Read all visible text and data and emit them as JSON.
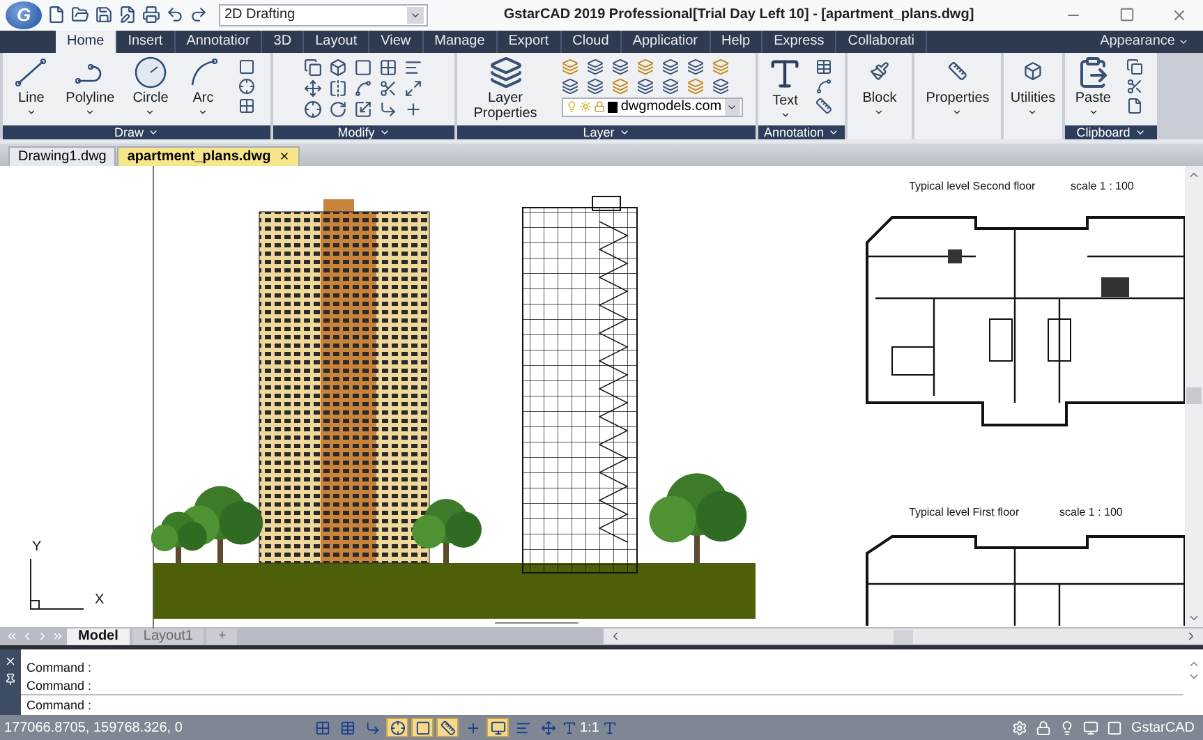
{
  "window": {
    "logo": "G",
    "title": "GstarCAD 2019 Professional[Trial Day Left 10] - [apartment_plans.dwg]",
    "workspace": "2D Drafting"
  },
  "ribbon_tabs": [
    {
      "label": "Home",
      "selected": true
    },
    {
      "label": "Insert",
      "selected": false
    },
    {
      "label": "Annotatior",
      "selected": false
    },
    {
      "label": "3D",
      "selected": false
    },
    {
      "label": "Layout",
      "selected": false
    },
    {
      "label": "View",
      "selected": false
    },
    {
      "label": "Manage",
      "selected": false
    },
    {
      "label": "Export",
      "selected": false
    },
    {
      "label": "Cloud",
      "selected": false
    },
    {
      "label": "Applicatior",
      "selected": false
    },
    {
      "label": "Help",
      "selected": false
    },
    {
      "label": "Express",
      "selected": false
    },
    {
      "label": "Collaborati",
      "selected": false
    }
  ],
  "appearance": "Appearance",
  "panels": [
    {
      "kind": "draw",
      "label": "Draw",
      "tools": [
        "Line",
        "Polyline",
        "Circle",
        "Arc"
      ]
    },
    {
      "kind": "modify",
      "label": "Modify"
    },
    {
      "kind": "layer",
      "label": "Layer",
      "tool": "Layer Properties",
      "layer": "dwgmodels.com"
    },
    {
      "kind": "annotation",
      "label": "Annotation",
      "tool": "Text"
    },
    {
      "kind": "single",
      "tool": "Block"
    },
    {
      "kind": "single",
      "tool": "Properties"
    },
    {
      "kind": "single",
      "tool": "Utilities"
    },
    {
      "kind": "clipboard",
      "label": "Clipboard",
      "tool": "Paste"
    }
  ],
  "doc_tabs": [
    {
      "label": "Drawing1.dwg",
      "selected": false
    },
    {
      "label": "apartment_plans.dwg",
      "selected": true
    }
  ],
  "drawing": {
    "plans": [
      {
        "title": "Typical level Second floor",
        "scale": "scale  1 : 100"
      },
      {
        "title": "Typical level First floor",
        "scale": "scale  1 : 100"
      }
    ],
    "ucs_y": "Y",
    "ucs_x": "X"
  },
  "layout_tabs": [
    {
      "label": "Model",
      "selected": true
    },
    {
      "label": "Layout1",
      "selected": false
    }
  ],
  "add_tab": "+",
  "command_lines": [
    "Command :",
    "Command :"
  ],
  "command_prompt": "Command :",
  "status": {
    "coords": "177066.8705, 159768.326, 0",
    "scale": "1:1",
    "brand": "GstarCAD"
  },
  "toggles": [
    {
      "kind": "grid",
      "on": false
    },
    {
      "kind": "snap",
      "on": false
    },
    {
      "kind": "ortho",
      "on": false
    },
    {
      "kind": "polar",
      "on": true
    },
    {
      "kind": "osnap",
      "on": true
    },
    {
      "kind": "otrack",
      "on": true
    },
    {
      "kind": "ducs",
      "on": false
    },
    {
      "kind": "dyn",
      "on": true
    },
    {
      "kind": "lineweight",
      "on": false
    },
    {
      "kind": "select",
      "on": false
    }
  ]
}
